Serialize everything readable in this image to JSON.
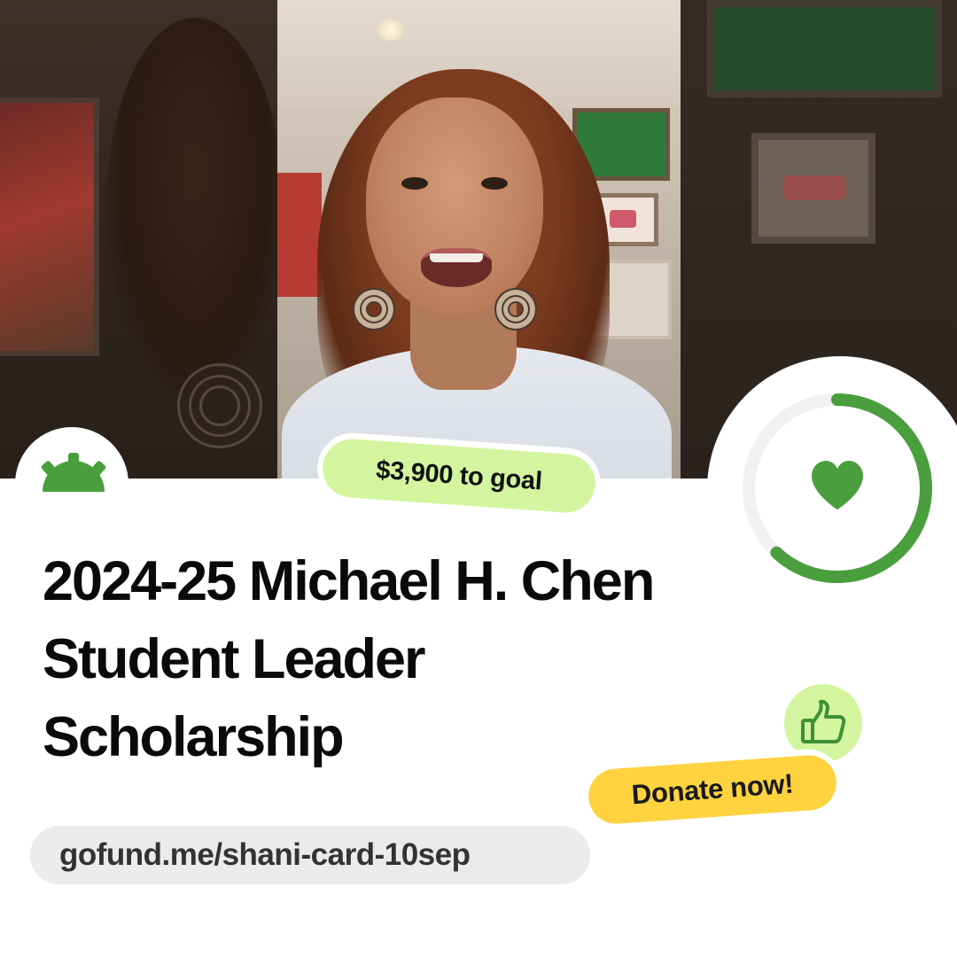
{
  "goal_badge": {
    "text": "$3,900 to goal"
  },
  "campaign": {
    "title": "2024-25 Michael H. Chen Student Leader Scholarship"
  },
  "donate_badge": {
    "text": "Donate now!"
  },
  "link": {
    "url": "gofund.me/shani-card-10sep"
  },
  "progress": {
    "fraction_raised": 0.62
  },
  "icons": {
    "brand": "gofundme-sunrise-logo-icon",
    "heart": "heart-icon",
    "thumb": "thumbs-up-icon"
  },
  "colors": {
    "brand_green": "#4a9e3e",
    "lime_badge": "#d4f5a0",
    "yellow_badge": "#ffd23f",
    "url_pill": "#ebebeb"
  }
}
